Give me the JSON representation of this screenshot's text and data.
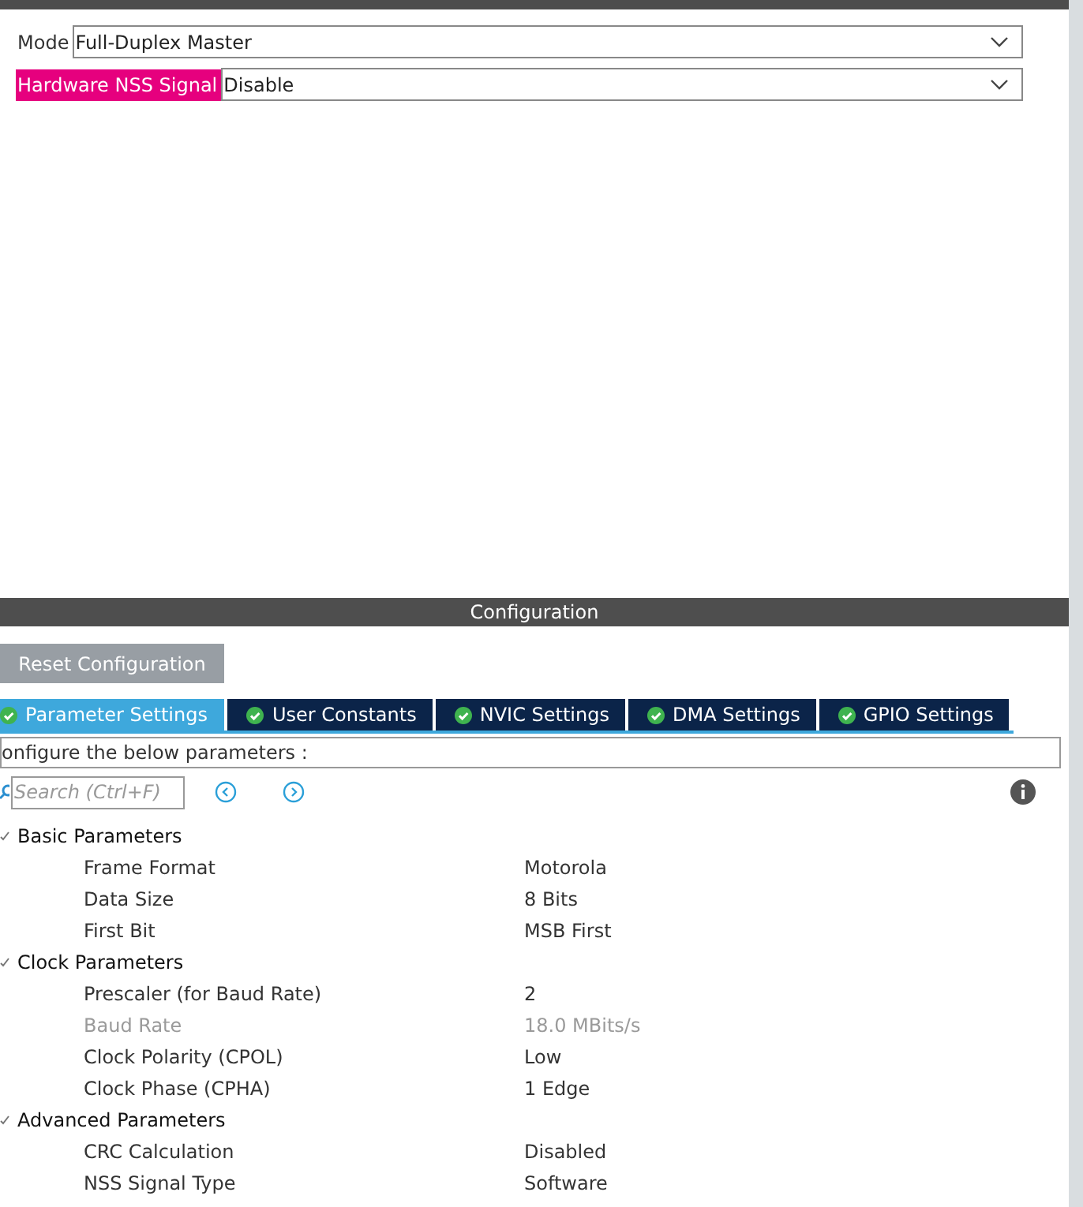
{
  "mode_panel": {
    "fields": [
      {
        "label": "Mode",
        "value": "Full-Duplex Master",
        "highlighted": false
      },
      {
        "label": "Hardware NSS Signal",
        "value": "Disable",
        "highlighted": true
      }
    ]
  },
  "configuration": {
    "title": "Configuration",
    "reset_button": "Reset Configuration",
    "tabs": [
      {
        "label": "Parameter Settings",
        "selected": true
      },
      {
        "label": "User Constants",
        "selected": false
      },
      {
        "label": "NVIC Settings",
        "selected": false
      },
      {
        "label": "DMA Settings",
        "selected": false
      },
      {
        "label": "GPIO Settings",
        "selected": false
      }
    ],
    "hint": "onfigure the below parameters :",
    "search": {
      "placeholder": "Search (Ctrl+F)"
    },
    "groups": [
      {
        "name": "Basic Parameters",
        "expanded": true,
        "children": [
          {
            "name": "Frame Format",
            "value": "Motorola",
            "disabled": false
          },
          {
            "name": "Data Size",
            "value": "8 Bits",
            "disabled": false
          },
          {
            "name": "First Bit",
            "value": "MSB First",
            "disabled": false
          }
        ]
      },
      {
        "name": "Clock Parameters",
        "expanded": true,
        "children": [
          {
            "name": "Prescaler (for Baud Rate)",
            "value": "2",
            "disabled": false
          },
          {
            "name": "Baud Rate",
            "value": "18.0 MBits/s",
            "disabled": true
          },
          {
            "name": "Clock Polarity (CPOL)",
            "value": "Low",
            "disabled": false
          },
          {
            "name": "Clock Phase (CPHA)",
            "value": "1 Edge",
            "disabled": false
          }
        ]
      },
      {
        "name": "Advanced Parameters",
        "expanded": true,
        "children": [
          {
            "name": "CRC Calculation",
            "value": "Disabled",
            "disabled": false
          },
          {
            "name": "NSS Signal Type",
            "value": "Software",
            "disabled": false
          }
        ]
      }
    ]
  }
}
